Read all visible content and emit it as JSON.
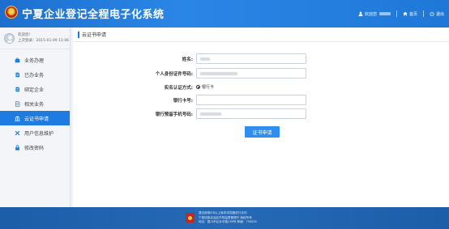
{
  "header": {
    "title": "宁夏企业登记全程电子化系统",
    "welcome": "欢迎您",
    "home": "首页",
    "logout": "退出"
  },
  "sidebar": {
    "user": {
      "greeting": "欢迎您!",
      "last_login": "上次登录：2015-01-09 11:06"
    },
    "items": [
      {
        "label": "业务办理",
        "icon": "briefcase-icon"
      },
      {
        "label": "已办业务",
        "icon": "document-icon"
      },
      {
        "label": "绑定企业",
        "icon": "document-icon"
      },
      {
        "label": "相关业务",
        "icon": "document-icon"
      },
      {
        "label": "云证书申请",
        "icon": "bank-icon"
      },
      {
        "label": "用户信息维护",
        "icon": "tools-icon"
      },
      {
        "label": "修改密码",
        "icon": "lock-icon"
      }
    ],
    "active_index": 4
  },
  "main": {
    "breadcrumb": "云证书申请",
    "form": {
      "name_label": "姓名:",
      "id_label": "个人身份证件号码:",
      "auth_label": "实名认证方式:",
      "auth_option": "银行卡",
      "card_label": "银行卡号:",
      "phone_label": "银行预留手机号码:",
      "submit": "证书申请"
    }
  },
  "footer": {
    "line1": "建议使用IE8以上版本浏览器进行访问",
    "line2": "宁夏回族自治区市场监督管理厅 版权所有",
    "line3": "地址：银川市北京中路136号 邮编：750002"
  },
  "colors": {
    "header_blue": "#1f78d8",
    "active_blue": "#1e7ce0",
    "button_blue": "#2f8ef0",
    "footer_blue": "#2669b5"
  }
}
